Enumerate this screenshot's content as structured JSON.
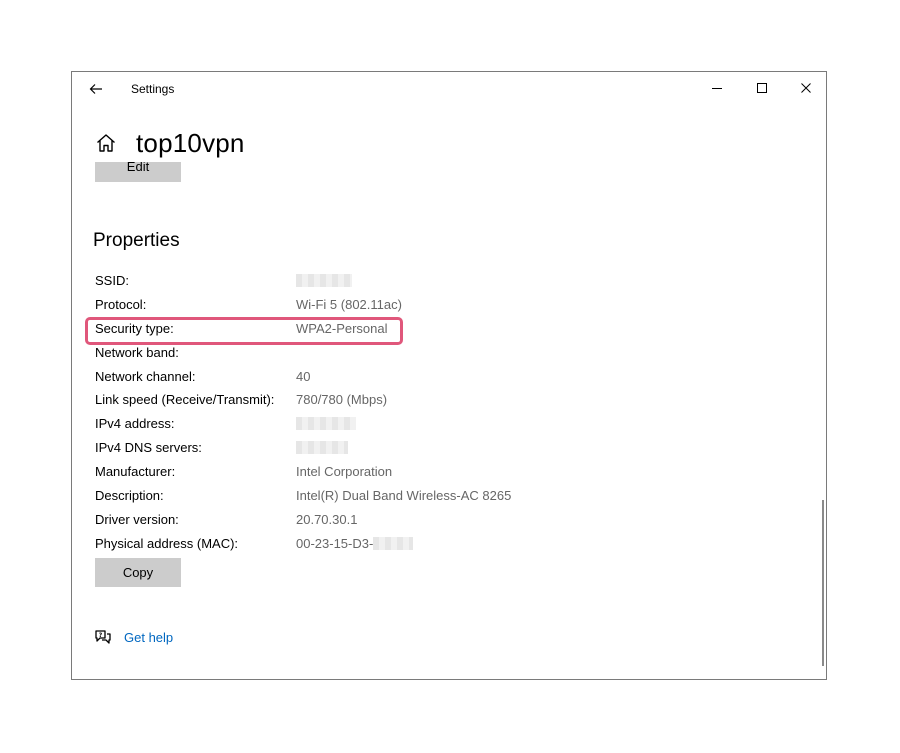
{
  "window": {
    "title": "Settings",
    "controls": {
      "back": "arrow-left-icon",
      "minimize": "minimize-icon",
      "maximize": "maximize-icon",
      "close": "close-icon"
    }
  },
  "header": {
    "icon": "home-icon",
    "title": "top10vpn"
  },
  "edit_button": {
    "label": "Edit"
  },
  "properties": {
    "heading": "Properties",
    "rows": [
      {
        "label": "SSID:",
        "value": "",
        "redacted": true
      },
      {
        "label": "Protocol:",
        "value": "Wi-Fi 5 (802.11ac)"
      },
      {
        "label": "Security type:",
        "value": "WPA2-Personal",
        "highlighted": true
      },
      {
        "label": "Network band:",
        "value": ""
      },
      {
        "label": "Network channel:",
        "value": "40"
      },
      {
        "label": "Link speed (Receive/Transmit):",
        "value": "780/780 (Mbps)"
      },
      {
        "label": "IPv4 address:",
        "value": "",
        "redacted": true
      },
      {
        "label": "IPv4 DNS servers:",
        "value": "",
        "redacted": true
      },
      {
        "label": "Manufacturer:",
        "value": "Intel Corporation"
      },
      {
        "label": "Description:",
        "value": "Intel(R) Dual Band Wireless-AC 8265"
      },
      {
        "label": "Driver version:",
        "value": "20.70.30.1"
      },
      {
        "label": "Physical address (MAC):",
        "value": "00-23-15-D3-",
        "redacted_suffix": true
      }
    ],
    "highlight_color": "#e0577b"
  },
  "copy_button": {
    "label": "Copy"
  },
  "help": {
    "icon": "help-chat-icon",
    "link_text": "Get help",
    "link_color": "#0067c0"
  }
}
